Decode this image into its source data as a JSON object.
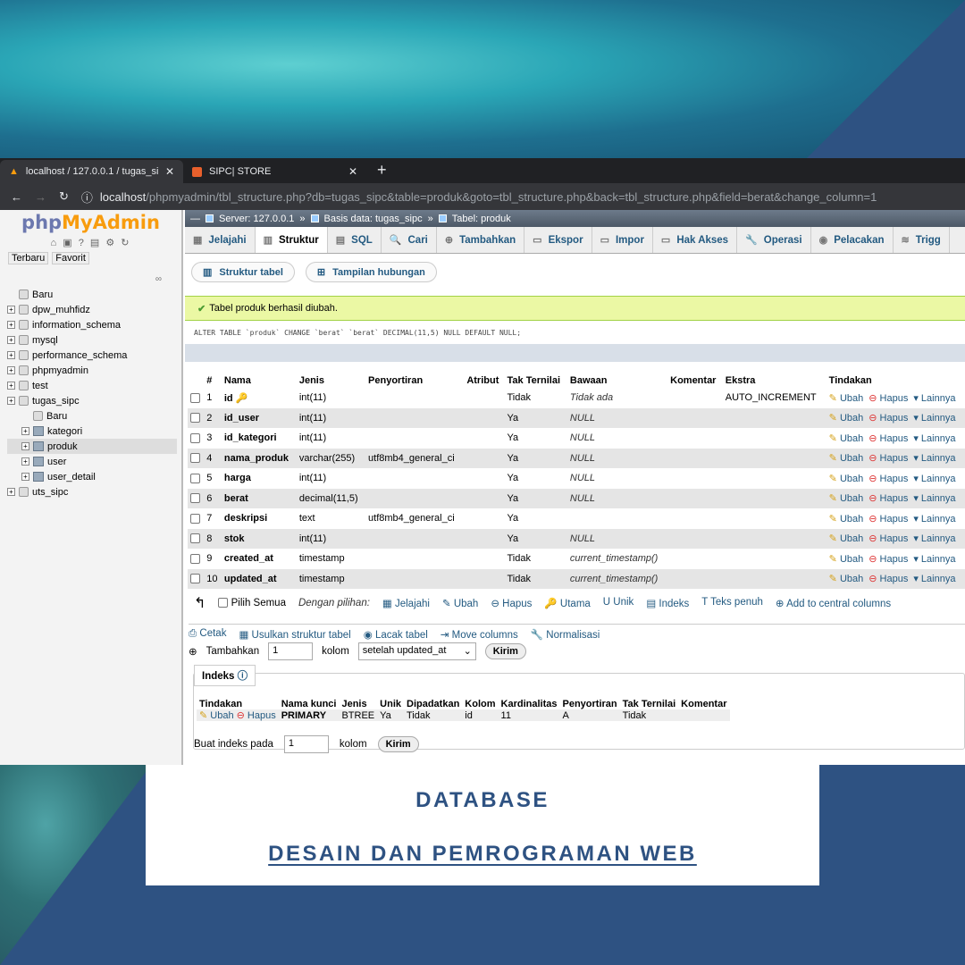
{
  "browser": {
    "tabs": [
      {
        "title": "localhost / 127.0.0.1 / tugas_sipc",
        "active": true
      },
      {
        "title": "SIPC| STORE",
        "active": false
      }
    ],
    "url_host": "localhost",
    "url_path": "/phpmyadmin/tbl_structure.php?db=tugas_sipc&table=produk&goto=tbl_structure.php&back=tbl_structure.php&field=berat&change_column=1"
  },
  "sidebar": {
    "logo_php": "php",
    "logo_my": "MyAdmin",
    "recent": "Terbaru",
    "favorite": "Favorit",
    "tree": [
      {
        "label": "Baru",
        "level": 0,
        "kind": "new"
      },
      {
        "label": "dpw_muhfidz",
        "level": 0,
        "kind": "db"
      },
      {
        "label": "information_schema",
        "level": 0,
        "kind": "db"
      },
      {
        "label": "mysql",
        "level": 0,
        "kind": "db"
      },
      {
        "label": "performance_schema",
        "level": 0,
        "kind": "db"
      },
      {
        "label": "phpmyadmin",
        "level": 0,
        "kind": "db"
      },
      {
        "label": "test",
        "level": 0,
        "kind": "db"
      },
      {
        "label": "tugas_sipc",
        "level": 0,
        "kind": "db"
      },
      {
        "label": "Baru",
        "level": 1,
        "kind": "new"
      },
      {
        "label": "kategori",
        "level": 1,
        "kind": "table"
      },
      {
        "label": "produk",
        "level": 1,
        "kind": "table",
        "selected": true
      },
      {
        "label": "user",
        "level": 1,
        "kind": "table"
      },
      {
        "label": "user_detail",
        "level": 1,
        "kind": "table"
      },
      {
        "label": "uts_sipc",
        "level": 0,
        "kind": "db"
      }
    ]
  },
  "breadcrumb": {
    "server": "Server: 127.0.0.1",
    "database": "Basis data: tugas_sipc",
    "table": "Tabel: produk"
  },
  "tabs": [
    "Jelajahi",
    "Struktur",
    "SQL",
    "Cari",
    "Tambahkan",
    "Ekspor",
    "Impor",
    "Hak Akses",
    "Operasi",
    "Pelacakan",
    "Trigg"
  ],
  "subtabs": [
    "Struktur tabel",
    "Tampilan hubungan"
  ],
  "success_message": "Tabel produk berhasil diubah.",
  "sql_query": "ALTER TABLE `produk` CHANGE `berat` `berat` DECIMAL(11,5) NULL DEFAULT NULL;",
  "columns_table": {
    "headers": [
      "#",
      "Nama",
      "Jenis",
      "Penyortiran",
      "Atribut",
      "Tak Ternilai",
      "Bawaan",
      "Komentar",
      "Ekstra",
      "Tindakan"
    ],
    "rows": [
      {
        "n": "1",
        "name": "id",
        "type": "int(11)",
        "collation": "",
        "attr": "",
        "null": "Tidak",
        "default": "Tidak ada",
        "comment": "",
        "extra": "AUTO_INCREMENT"
      },
      {
        "n": "2",
        "name": "id_user",
        "type": "int(11)",
        "collation": "",
        "attr": "",
        "null": "Ya",
        "default": "NULL",
        "comment": "",
        "extra": ""
      },
      {
        "n": "3",
        "name": "id_kategori",
        "type": "int(11)",
        "collation": "",
        "attr": "",
        "null": "Ya",
        "default": "NULL",
        "comment": "",
        "extra": ""
      },
      {
        "n": "4",
        "name": "nama_produk",
        "type": "varchar(255)",
        "collation": "utf8mb4_general_ci",
        "attr": "",
        "null": "Ya",
        "default": "NULL",
        "comment": "",
        "extra": ""
      },
      {
        "n": "5",
        "name": "harga",
        "type": "int(11)",
        "collation": "",
        "attr": "",
        "null": "Ya",
        "default": "NULL",
        "comment": "",
        "extra": ""
      },
      {
        "n": "6",
        "name": "berat",
        "type": "decimal(11,5)",
        "collation": "",
        "attr": "",
        "null": "Ya",
        "default": "NULL",
        "comment": "",
        "extra": ""
      },
      {
        "n": "7",
        "name": "deskripsi",
        "type": "text",
        "collation": "utf8mb4_general_ci",
        "attr": "",
        "null": "Ya",
        "default": "",
        "comment": "",
        "extra": ""
      },
      {
        "n": "8",
        "name": "stok",
        "type": "int(11)",
        "collation": "",
        "attr": "",
        "null": "Ya",
        "default": "NULL",
        "comment": "",
        "extra": ""
      },
      {
        "n": "9",
        "name": "created_at",
        "type": "timestamp",
        "collation": "",
        "attr": "",
        "null": "Tidak",
        "default": "current_timestamp()",
        "comment": "",
        "extra": ""
      },
      {
        "n": "10",
        "name": "updated_at",
        "type": "timestamp",
        "collation": "",
        "attr": "",
        "null": "Tidak",
        "default": "current_timestamp()",
        "comment": "",
        "extra": ""
      }
    ],
    "action_edit": "Ubah",
    "action_delete": "Hapus",
    "action_more": "Lainnya"
  },
  "with_selected": {
    "check_all": "Pilih Semua",
    "label": "Dengan pilihan:",
    "actions": [
      "Jelajahi",
      "Ubah",
      "Hapus",
      "Utama",
      "Unik",
      "Indeks",
      "Teks penuh",
      "Add to central columns"
    ]
  },
  "operations": [
    "Cetak",
    "Usulkan struktur tabel",
    "Lacak tabel",
    "Move columns",
    "Normalisasi"
  ],
  "add_columns": {
    "label": "Tambahkan",
    "value": "1",
    "unit": "kolom",
    "position": "setelah updated_at",
    "button": "Kirim"
  },
  "indexes": {
    "legend": "Indeks",
    "headers": [
      "Tindakan",
      "Nama kunci",
      "Jenis",
      "Unik",
      "Dipadatkan",
      "Kolom",
      "Kardinalitas",
      "Penyortiran",
      "Tak Ternilai",
      "Komentar"
    ],
    "row": {
      "edit": "Ubah",
      "delete": "Hapus",
      "key": "PRIMARY",
      "type": "BTREE",
      "unique": "Ya",
      "packed": "Tidak",
      "column": "id",
      "cardinality": "11",
      "collation": "A",
      "null": "Tidak",
      "comment": ""
    },
    "create_label": "Buat indeks pada",
    "create_value": "1",
    "create_unit": "kolom",
    "create_button": "Kirim"
  },
  "banner": {
    "line1": "DATABASE",
    "line2": "DESAIN DAN PEMROGRAMAN WEB"
  }
}
